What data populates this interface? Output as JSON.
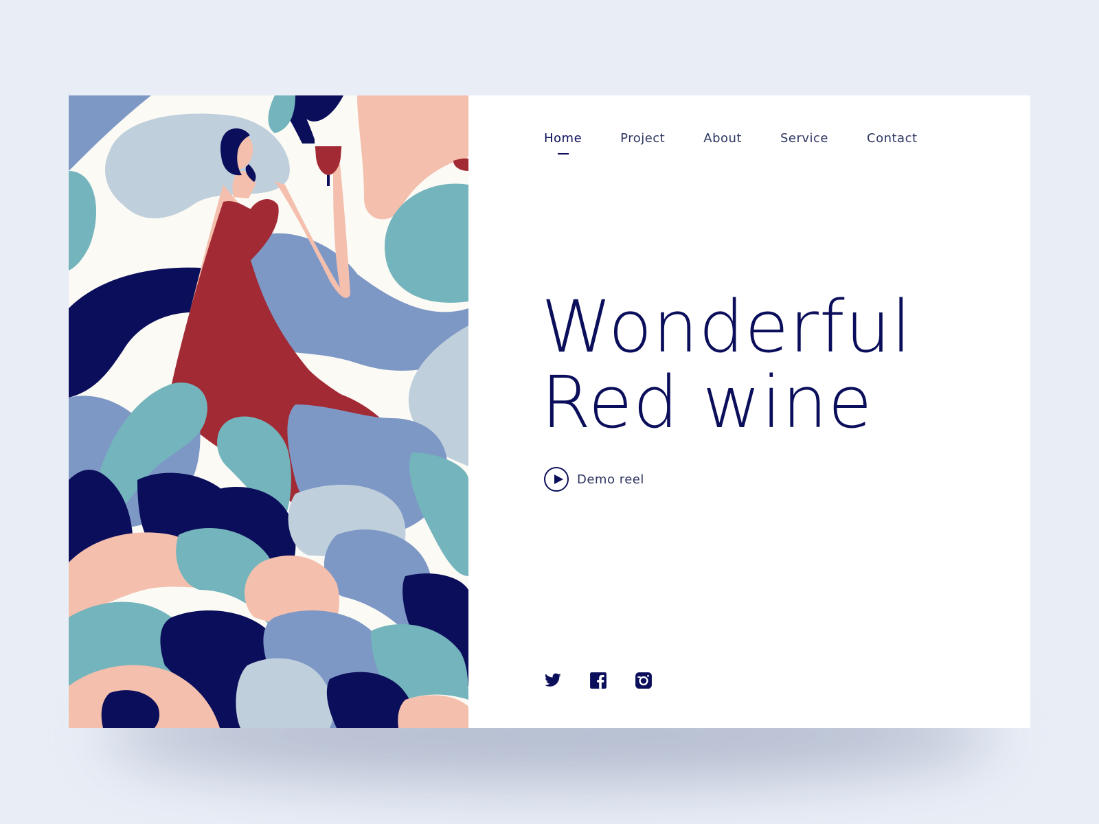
{
  "nav": {
    "items": [
      {
        "label": "Home",
        "active": true
      },
      {
        "label": "Project",
        "active": false
      },
      {
        "label": "About",
        "active": false
      },
      {
        "label": "Service",
        "active": false
      },
      {
        "label": "Contact",
        "active": false
      }
    ]
  },
  "hero": {
    "title_line1": "Wonderful",
    "title_line2": "Red wine",
    "cta_label": "Demo reel"
  },
  "social": [
    "twitter-icon",
    "facebook-icon",
    "instagram-icon"
  ],
  "colors": {
    "navy": "#0b0e5a",
    "wine": "#a22a35",
    "peach": "#f4bfad",
    "teal": "#74b4bc",
    "periwinkle": "#7e98c6",
    "pale_blue": "#bfd0dc",
    "cream": "#fbfaf5"
  }
}
